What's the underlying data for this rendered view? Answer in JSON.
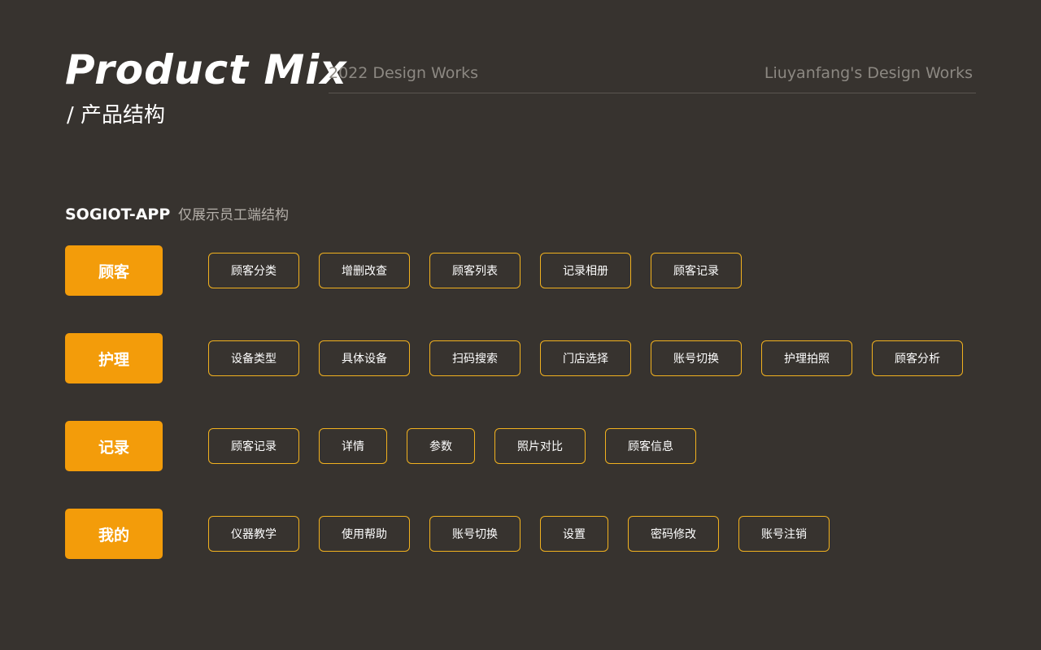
{
  "header": {
    "title": "Product Mix",
    "subtitle": "/ 产品结构",
    "left_caption": "2022 Design Works",
    "right_caption": "Liuyanfang's Design Works"
  },
  "section": {
    "app_name": "SOGIOT-APP",
    "note": "仅展示员工端结构"
  },
  "rows": [
    {
      "category": "顾客",
      "items": [
        "顾客分类",
        "增删改查",
        "顾客列表",
        "记录相册",
        "顾客记录"
      ]
    },
    {
      "category": "护理",
      "items": [
        "设备类型",
        "具体设备",
        "扫码搜索",
        "门店选择",
        "账号切换",
        "护理拍照",
        "顾客分析"
      ]
    },
    {
      "category": "记录",
      "items": [
        "顾客记录",
        "详情",
        "参数",
        "照片对比",
        "顾客信息"
      ]
    },
    {
      "category": "我的",
      "items": [
        "仪器教学",
        "使用帮助",
        "账号切换",
        "设置",
        "密码修改",
        "账号注销"
      ]
    }
  ],
  "colors": {
    "background": "#37332f",
    "accent": "#f39c0a",
    "item_border": "#f1b11f",
    "muted_text": "#8c8882"
  }
}
